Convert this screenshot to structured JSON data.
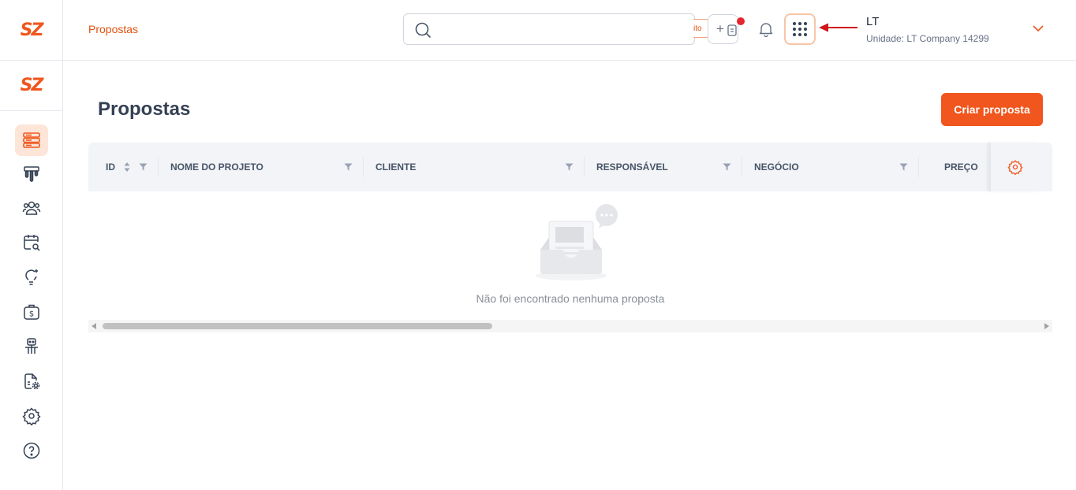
{
  "brand": {
    "logo_text": "SZ",
    "color": "#f0561d"
  },
  "header": {
    "breadcrumb": "Propostas",
    "search": {
      "placeholder": "",
      "tag": "ito"
    },
    "user": {
      "initials": "LT",
      "unit": "Unidade: LT Company 14299"
    },
    "icons": [
      "search-icon",
      "quick-add-icon",
      "notification-bell-icon",
      "apps-grid-icon",
      "chevron-down-icon"
    ]
  },
  "sidebar": {
    "items": [
      {
        "name": "proposals",
        "icon": "stack-list-icon",
        "active": true
      },
      {
        "name": "funnel",
        "icon": "pipeline-icon",
        "active": false
      },
      {
        "name": "contacts",
        "icon": "users-icon",
        "active": false
      },
      {
        "name": "calendar",
        "icon": "calendar-search-icon",
        "active": false
      },
      {
        "name": "ideas",
        "icon": "lightbulb-icon",
        "active": false
      },
      {
        "name": "finance",
        "icon": "money-bag-icon",
        "active": false
      },
      {
        "name": "robot",
        "icon": "robot-icon",
        "active": false
      },
      {
        "name": "documents",
        "icon": "document-settings-icon",
        "active": false
      },
      {
        "name": "settings",
        "icon": "gear-icon",
        "active": false
      },
      {
        "name": "help",
        "icon": "help-circle-icon",
        "active": false
      }
    ]
  },
  "main": {
    "title": "Propostas",
    "create_button": "Criar proposta",
    "table": {
      "columns": [
        "ID",
        "NOME DO PROJETO",
        "CLIENTE",
        "RESPONSÁVEL",
        "NEGÓCIO",
        "PREÇO"
      ],
      "rows": [],
      "empty_text": "Não foi encontrado nenhuma proposta"
    }
  }
}
